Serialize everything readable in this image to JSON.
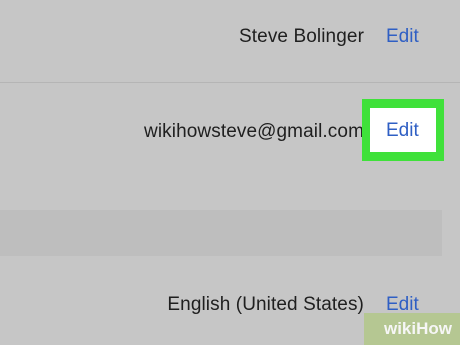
{
  "account": {
    "name": {
      "value": "Steve Bolinger",
      "edit_label": "Edit"
    },
    "email": {
      "value": "wikihowsteve@gmail.com",
      "edit_label": "Edit"
    },
    "language": {
      "value": "English (United States)",
      "edit_label": "Edit"
    }
  },
  "highlight_color": "#3fe13a",
  "link_color": "#2f5fc4",
  "watermark": {
    "text": "wikiHow"
  }
}
